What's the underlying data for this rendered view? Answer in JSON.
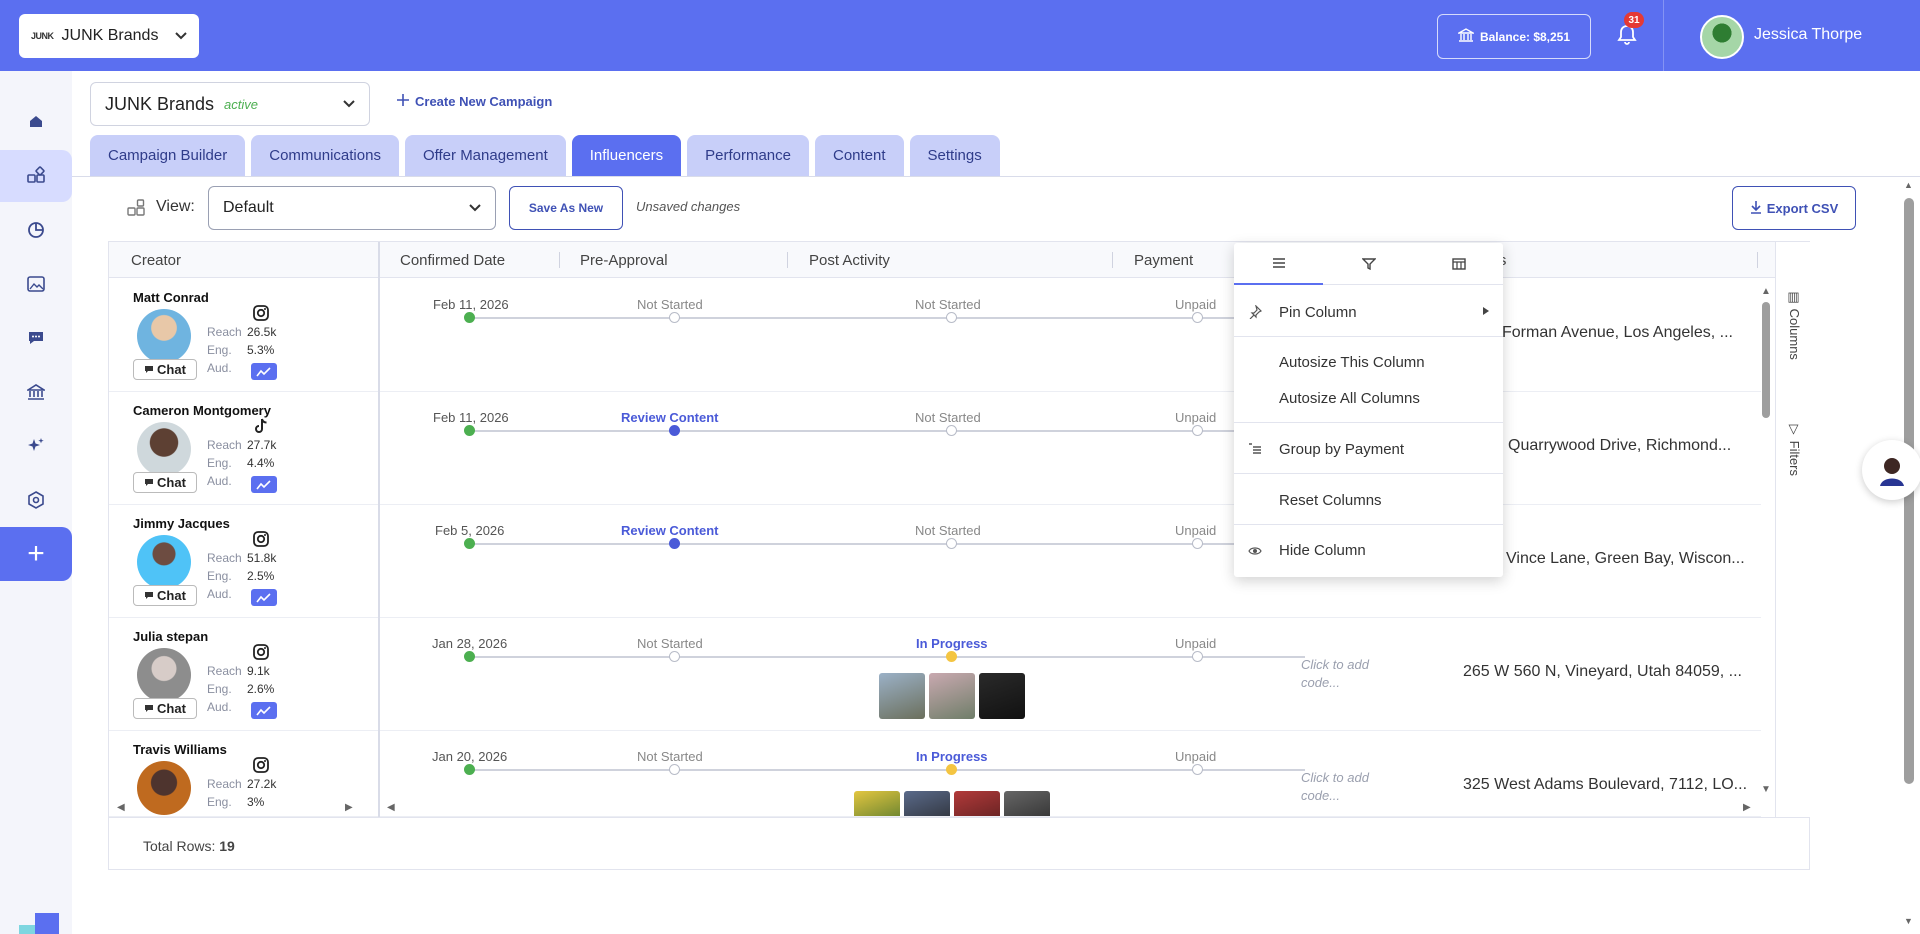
{
  "topbar": {
    "brand_logo": "JUNK",
    "brand_name": "JUNK Brands",
    "balance": "Balance: $8,251",
    "notifications_count": "31",
    "user_name": "Jessica Thorpe"
  },
  "campaign": {
    "name": "JUNK Brands",
    "status": "active",
    "create_label": "Create New Campaign"
  },
  "tabs": [
    {
      "label": "Campaign Builder"
    },
    {
      "label": "Communications"
    },
    {
      "label": "Offer Management"
    },
    {
      "label": "Influencers"
    },
    {
      "label": "Performance"
    },
    {
      "label": "Content"
    },
    {
      "label": "Settings"
    }
  ],
  "toolbar": {
    "view_label": "View:",
    "view_value": "Default",
    "save_new": "Save As New",
    "unsaved": "Unsaved changes",
    "export": "Export CSV"
  },
  "grid": {
    "headers": {
      "creator": "Creator",
      "confirmed_date": "Confirmed Date",
      "pre_approval": "Pre-Approval",
      "post_activity": "Post Activity",
      "payment": "Payment",
      "address_partial": "ess"
    },
    "stat_labels": {
      "reach": "Reach",
      "eng": "Eng.",
      "aud": "Aud."
    },
    "chat_label": "Chat",
    "rows": [
      {
        "name": "Matt Conrad",
        "social": "instagram",
        "reach": "26.5k",
        "eng": "5.3%",
        "date": "Feb 11, 2026",
        "pre": "Not Started",
        "post": "Not Started",
        "payment": "Unpaid",
        "code": "",
        "address": "Forman Avenue, Los Angeles, ..."
      },
      {
        "name": "Cameron Montgomery",
        "social": "tiktok",
        "reach": "27.7k",
        "eng": "4.4%",
        "date": "Feb 11, 2026",
        "pre": "Review Content",
        "post": "Not Started",
        "payment": "Unpaid",
        "code": "",
        "address": "Quarrywood Drive, Richmond..."
      },
      {
        "name": "Jimmy Jacques",
        "social": "instagram",
        "reach": "51.8k",
        "eng": "2.5%",
        "date": "Feb 5, 2026",
        "pre": "Review Content",
        "post": "Not Started",
        "payment": "Unpaid",
        "code": "",
        "address": "Vince Lane, Green Bay, Wiscon..."
      },
      {
        "name": "Julia stepan",
        "social": "instagram",
        "reach": "9.1k",
        "eng": "2.6%",
        "date": "Jan 28, 2026",
        "pre": "Not Started",
        "post": "In Progress",
        "payment": "Unpaid",
        "code": "Click to add code...",
        "address": "265 W 560 N, Vineyard, Utah 84059, ..."
      },
      {
        "name": "Travis Williams",
        "social": "instagram",
        "reach": "27.2k",
        "eng": "3%",
        "date": "Jan 20, 2026",
        "pre": "Not Started",
        "post": "In Progress",
        "payment": "Unpaid",
        "code": "Click to add code...",
        "address": "325 West Adams Boulevard, 7112, LO..."
      }
    ],
    "side_columns": "Columns",
    "side_filters": "Filters",
    "total_rows_label": "Total Rows:",
    "total_rows_value": "19"
  },
  "column_menu": {
    "pin": "Pin Column",
    "autosize_this": "Autosize This Column",
    "autosize_all": "Autosize All Columns",
    "group_by": "Group by Payment",
    "reset": "Reset Columns",
    "hide": "Hide Column"
  },
  "colors": {
    "brand": "#5b6ff0",
    "tab_inactive": "#c8cff9",
    "review": "#4a5ad8",
    "done": "#4caf50",
    "in_progress": "#f4c542"
  }
}
